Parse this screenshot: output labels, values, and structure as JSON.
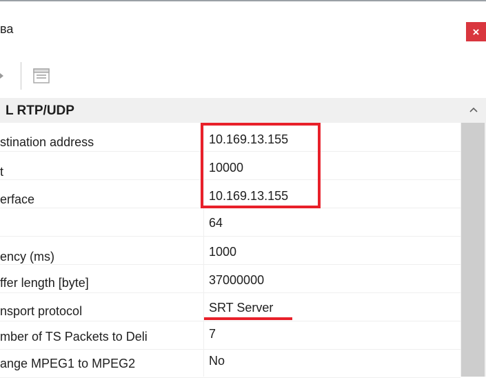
{
  "window": {
    "title": "ва",
    "close_label": "×"
  },
  "toolbar": {
    "icons": [
      "arrow-icon",
      "property-pages-icon"
    ]
  },
  "category": {
    "label": "L RTP/UDP"
  },
  "properties": [
    {
      "name": "stination address",
      "value": "10.169.13.155"
    },
    {
      "name": "t",
      "value": "10000"
    },
    {
      "name": "erface",
      "value": "10.169.13.155"
    },
    {
      "name": "",
      "value": "64"
    },
    {
      "name": "ency (ms)",
      "value": "1000"
    },
    {
      "name": "ffer length [byte]",
      "value": "37000000"
    },
    {
      "name": "nsport protocol",
      "value": "SRT Server"
    },
    {
      "name": "mber of TS Packets to Deli",
      "value": "7"
    },
    {
      "name": "ange MPEG1 to MPEG2",
      "value": "No"
    }
  ],
  "colors": {
    "highlight": "#e8202a",
    "close_button": "#d9363e",
    "category_bg": "#f0f0f0",
    "scrollbar_thumb": "#cdcdcd"
  }
}
